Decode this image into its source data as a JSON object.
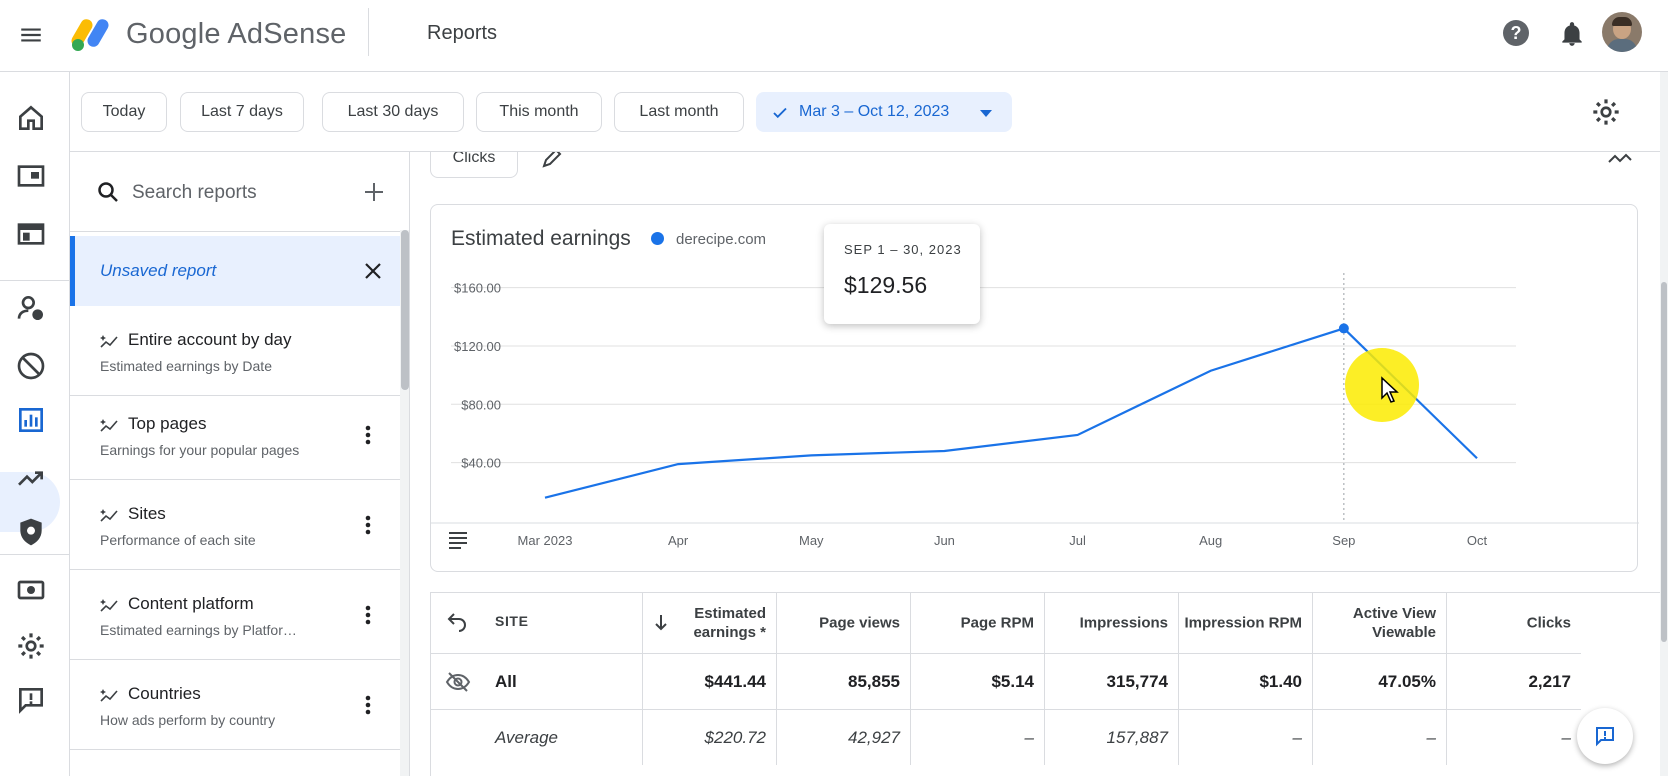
{
  "header": {
    "brand": "Google AdSense",
    "page_title": "Reports"
  },
  "leftnav": {
    "items": [
      {
        "icon": "home-icon"
      },
      {
        "icon": "sites-icon"
      },
      {
        "icon": "ads-icon"
      },
      {
        "icon": "users-icon"
      },
      {
        "icon": "block-icon"
      },
      {
        "icon": "reports-icon",
        "active": true
      },
      {
        "icon": "trending-icon"
      },
      {
        "icon": "privacy-icon"
      },
      {
        "icon": "payments-icon"
      },
      {
        "icon": "settings-icon"
      },
      {
        "icon": "feedback-icon"
      }
    ]
  },
  "datebar": {
    "today": "Today",
    "last7": "Last 7 days",
    "last30": "Last 30 days",
    "this_month": "This month",
    "last_month": "Last month",
    "range": "Mar 3 – Oct 12, 2023"
  },
  "reports_panel": {
    "search_placeholder": "Search reports",
    "unsaved": "Unsaved report",
    "items": [
      {
        "title": "Entire account by day",
        "subtitle": "Estimated earnings by Date"
      },
      {
        "title": "Top pages",
        "subtitle": "Earnings for your popular pages"
      },
      {
        "title": "Sites",
        "subtitle": "Performance of each site"
      },
      {
        "title": "Content platform",
        "subtitle": "Estimated earnings by Platfor…"
      },
      {
        "title": "Countries",
        "subtitle": "How ads perform by country"
      }
    ]
  },
  "main": {
    "metric_chip": "Clicks"
  },
  "chart_data": {
    "type": "line",
    "title": "Estimated earnings",
    "series": [
      {
        "name": "derecipe.com",
        "values": [
          16,
          39,
          45,
          48,
          59,
          103,
          132,
          43
        ]
      }
    ],
    "x": [
      "Mar 2023",
      "Apr",
      "May",
      "Jun",
      "Jul",
      "Aug",
      "Sep",
      "Oct"
    ],
    "ylim": [
      0,
      170
    ],
    "yticks": [
      "$40.00",
      "$80.00",
      "$120.00",
      "$160.00"
    ],
    "ytick_values": [
      40,
      80,
      120,
      160
    ],
    "grid": true,
    "color": "#1a73e8",
    "tooltip": {
      "date": "SEP 1 – 30, 2023",
      "value": "$129.56"
    }
  },
  "table": {
    "headers": [
      "SITE",
      "Estimated earnings *",
      "Page views",
      "Page RPM",
      "Impressions",
      "Impression RPM",
      "Active View Viewable",
      "Clicks"
    ],
    "rows": [
      {
        "label": "All",
        "values": [
          "$441.44",
          "85,855",
          "$5.14",
          "315,774",
          "$1.40",
          "47.05%",
          "2,217"
        ]
      },
      {
        "label": "Average",
        "values": [
          "$220.72",
          "42,927",
          "–",
          "157,887",
          "–",
          "–",
          "–"
        ]
      }
    ]
  }
}
